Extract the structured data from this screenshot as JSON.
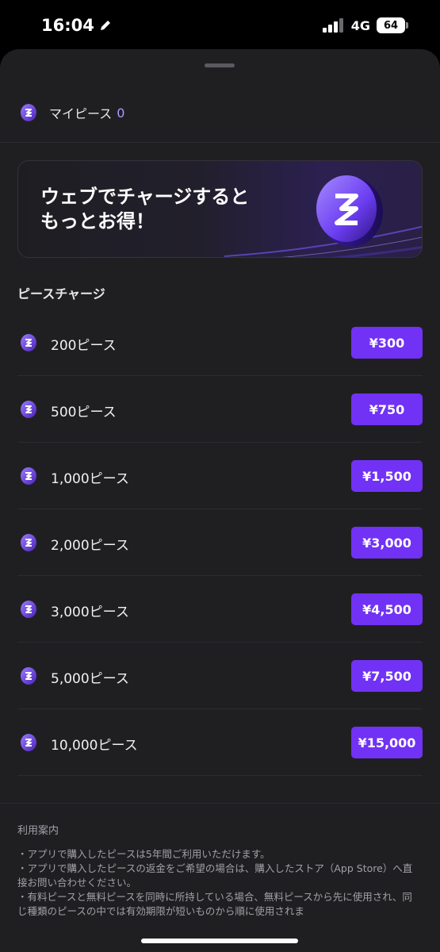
{
  "status_bar": {
    "time": "16:04",
    "network": "4G",
    "battery": "64"
  },
  "balance": {
    "label": "マイピース",
    "count": "0"
  },
  "banner": {
    "line1": "ウェブでチャージすると",
    "line2": "もっとお得！"
  },
  "charge_section": {
    "title": "ピースチャージ",
    "packs": [
      {
        "label": "200ピース",
        "price": "¥300"
      },
      {
        "label": "500ピース",
        "price": "¥750"
      },
      {
        "label": "1,000ピース",
        "price": "¥1,500"
      },
      {
        "label": "2,000ピース",
        "price": "¥3,000"
      },
      {
        "label": "3,000ピース",
        "price": "¥4,500"
      },
      {
        "label": "5,000ピース",
        "price": "¥7,500"
      },
      {
        "label": "10,000ピース",
        "price": "¥15,000"
      }
    ]
  },
  "usage_info": {
    "title": "利用案内",
    "lines": [
      "・アプリで購入したピースは5年間ご利用いただけます。",
      "・アプリで購入したピースの返金をご希望の場合は、購入したストア（App Store）へ直接お問い合わせください。",
      "・有料ピースと無料ピースを同時に所持している場合、無料ピースから先に使用され、同じ種類のピースの中では有効期限が短いものから順に使用されま"
    ]
  },
  "colors": {
    "accent": "#7132f5",
    "sheet_background": "#1f1f22",
    "count_highlight": "#a89bff"
  }
}
